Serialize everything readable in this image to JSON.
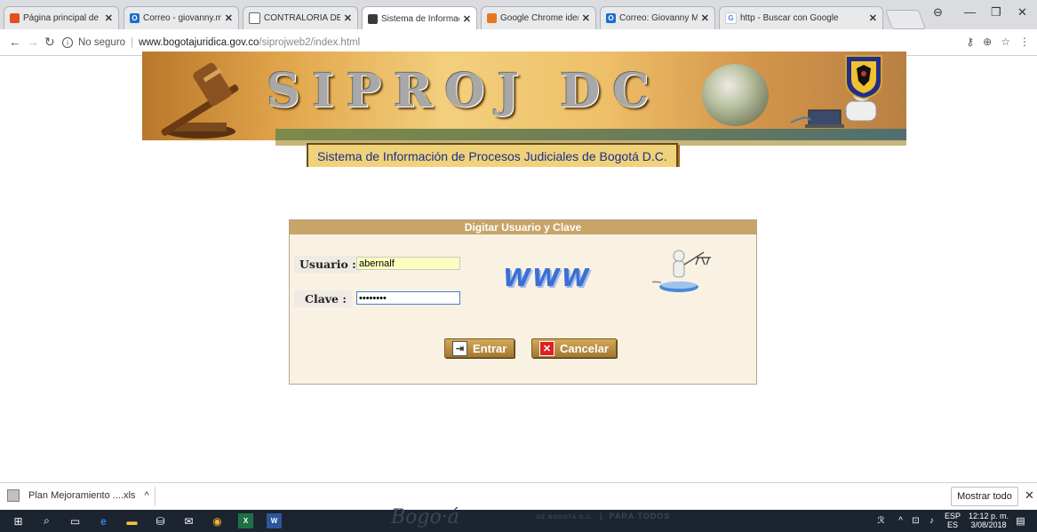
{
  "browser": {
    "tabs": [
      {
        "label": "Página principal de Micro",
        "favicon_color": "#e3501b",
        "favicon_text": ""
      },
      {
        "label": "Correo - giovanny.mance",
        "favicon_color": "#1f6ec9",
        "favicon_text": "O"
      },
      {
        "label": "CONTRALORÍA DE BOGO",
        "favicon_color": "#ffffff",
        "favicon_text": ""
      },
      {
        "label": "Sistema de Informaci�n",
        "favicon_color": "#3b3b3b",
        "favicon_text": ""
      },
      {
        "label": "Google Chrome identific",
        "favicon_color": "#e87722",
        "favicon_text": ""
      },
      {
        "label": "Correo: Giovanny Mance",
        "favicon_color": "#1f6ec9",
        "favicon_text": "O"
      },
      {
        "label": "http - Buscar con Google",
        "favicon_color": "#ffffff",
        "favicon_text": "G"
      }
    ],
    "active_tab": 3,
    "address": {
      "security_label": "No seguro",
      "host": "www.bogotajuridica.gov.co",
      "path": "/siprojweb2/index.html"
    }
  },
  "page": {
    "banner": {
      "title": "SIPROJ DC",
      "subtitle": "Sistema de Información de Procesos Judiciales de Bogotá D.C."
    },
    "login": {
      "header": "Digitar Usuario y Clave",
      "user_label": "Usuario :",
      "user_value": "abernalf",
      "password_label": "Clave :",
      "password_value": "••••••••",
      "www_text": "WWW",
      "enter_label": "Entrar",
      "cancel_label": "Cancelar"
    }
  },
  "download_shelf": {
    "file_label": "Plan Mejoramiento ....xls",
    "show_all_label": "Mostrar todo"
  },
  "taskbar": {
    "watermark_left": "Bogo·á",
    "watermark_mid": "DE BOGOTÁ D.C.",
    "watermark_right": "PARA TODOS",
    "lang_top": "ESP",
    "lang_bottom": "ES",
    "time": "12:12 p. m.",
    "date": "3/08/2018"
  },
  "colors": {
    "login_header": "#c7a468",
    "panel_bg": "#f9f2e3",
    "www_blue": "#3b6fd4",
    "subtitle_text": "#1a2f8a"
  }
}
